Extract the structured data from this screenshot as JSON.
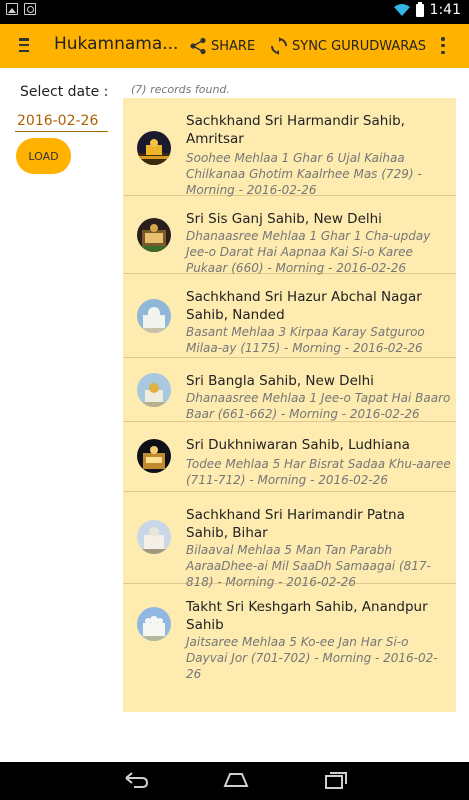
{
  "status": {
    "time": "1:41"
  },
  "appbar": {
    "title": "Hukamnama...",
    "share_label": "SHARE",
    "sync_label": "SYNC GURUDWARAS"
  },
  "form": {
    "date_label": "Select date :",
    "date_value": "2016-02-26",
    "load_label": "LOAD"
  },
  "records_text": "(7) records found.",
  "items": [
    {
      "title": "Sachkhand Sri Harmandir Sahib, Amritsar",
      "subtitle": "Soohee Mehlaa 1 Ghar 6 Ujal Kaihaa Chilkanaa Ghotim Kaalrhee Mas (729) - Morning - 2016-02-26",
      "thumb": "golden-temple-night"
    },
    {
      "title": "Sri Sis Ganj Sahib, New Delhi",
      "subtitle": "Dhanaasree Mehlaa 1 Ghar 1 Cha-upday Jee-o Darat Hai Aapnaa Kai Si-o Karee Pukaar (660) - Morning - 2016-02-26",
      "thumb": "gurudwara-night"
    },
    {
      "title": "Sachkhand Sri Hazur Abchal Nagar Sahib, Nanded",
      "subtitle": "Basant Mehlaa 3 Kirpaa Karay Satguroo Milaa-ay (1175) - Morning - 2016-02-26",
      "thumb": "white-dome"
    },
    {
      "title": "Sri Bangla Sahib, New Delhi",
      "subtitle": "Dhanaasree Mehlaa 1 Jee-o Tapat Hai Baaro Baar (661-662) - Morning - 2016-02-26",
      "thumb": "golden-dome-day"
    },
    {
      "title": "Sri Dukhniwaran Sahib, Ludhiana",
      "subtitle": "Todee Mehlaa 5 Har Bisrat Sadaa Khu-aaree (711-712) - Morning - 2016-02-26",
      "thumb": "gurudwara-night-lit"
    },
    {
      "title": "Sachkhand Sri Harimandir Patna Sahib, Bihar",
      "subtitle": "Bilaaval Mehlaa 5 Man Tan Parabh AaraaDhee-ai Mil SaaDh Samaagai (817-818) - Morning - 2016-02-26",
      "thumb": "white-gurudwara"
    },
    {
      "title": "Takht Sri Keshgarh Sahib, Anandpur Sahib",
      "subtitle": "Jaitsaree Mehlaa 5 Ko-ee Jan Har Si-o Dayvai Jor (701-702) - Morning - 2016-02-26",
      "thumb": "white-gurudwara-sky"
    }
  ]
}
